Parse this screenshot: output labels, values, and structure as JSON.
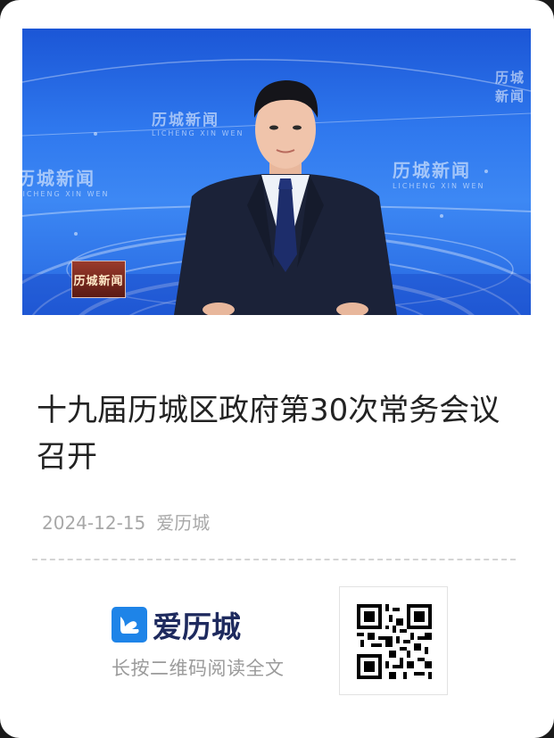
{
  "hero": {
    "watermark": "历城新闻",
    "watermark_sub": "LICHENG XIN WEN",
    "station_logo": "历城新闻"
  },
  "article": {
    "title": "十九届历城区政府第30次常务会议召开",
    "date": "2024-12-15",
    "source": "爱历城"
  },
  "footer": {
    "brand_name": "爱历城",
    "brand_icon": "aili-logo-icon",
    "hint": "长按二维码阅读全文",
    "qr_icon": "qr-code-icon"
  },
  "colors": {
    "title": "#222222",
    "meta": "#a8a8a8",
    "brand_blue": "#1e84e8",
    "brand_text": "#1e2a5e"
  }
}
